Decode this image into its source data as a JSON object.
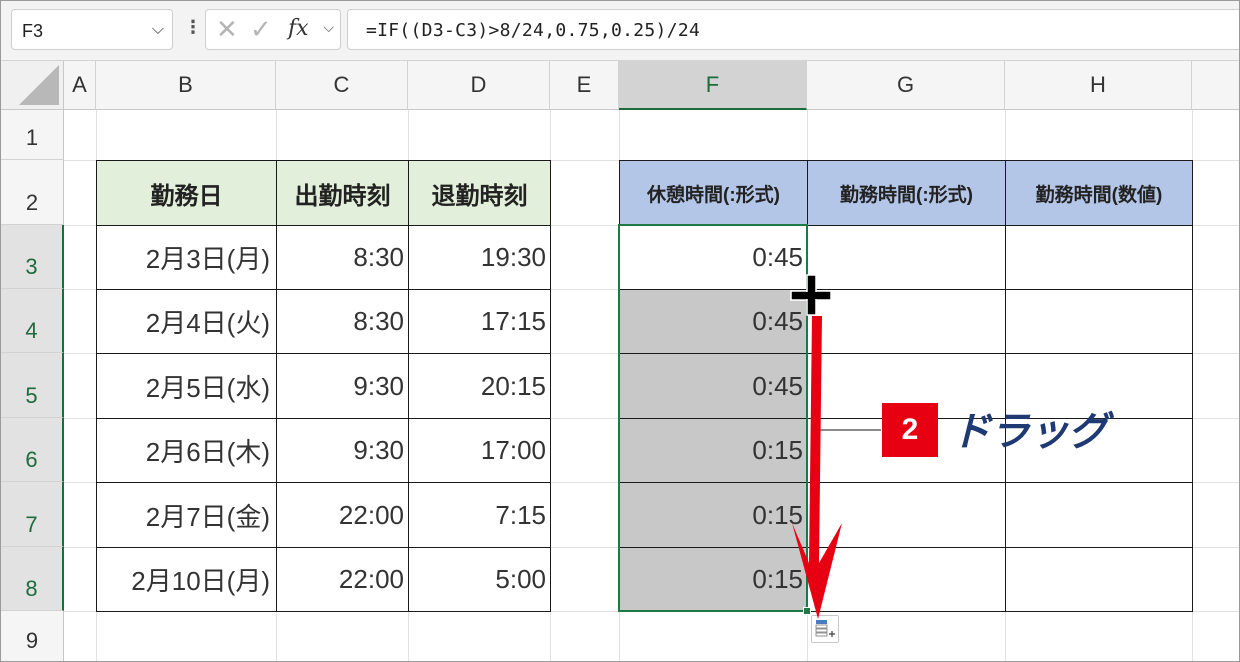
{
  "formula_bar": {
    "name_box": "F3",
    "cancel_icon": "✕",
    "enter_icon": "✓",
    "fx_label": "fx",
    "formula": "=IF((D3-C3)>8/24,0.75,0.25)/24"
  },
  "column_headers": [
    "A",
    "B",
    "C",
    "D",
    "E",
    "F",
    "G",
    "H"
  ],
  "row_headers": [
    "1",
    "2",
    "3",
    "4",
    "5",
    "6",
    "7",
    "8",
    "9"
  ],
  "left_table": {
    "headers": [
      "勤務日",
      "出勤時刻",
      "退勤時刻"
    ],
    "rows": [
      [
        "2月3日(月)",
        "8:30",
        "19:30"
      ],
      [
        "2月4日(火)",
        "8:30",
        "17:15"
      ],
      [
        "2月5日(水)",
        "9:30",
        "20:15"
      ],
      [
        "2月6日(木)",
        "9:30",
        "17:00"
      ],
      [
        "2月7日(金)",
        "22:00",
        "7:15"
      ],
      [
        "2月10日(月)",
        "22:00",
        "5:00"
      ]
    ]
  },
  "right_table": {
    "headers": [
      "休憩時間(:形式)",
      "勤務時間(:形式)",
      "勤務時間(数値)"
    ],
    "f_values": [
      "0:45",
      "0:45",
      "0:45",
      "0:15",
      "0:15",
      "0:15"
    ]
  },
  "annotation": {
    "step_number": "2",
    "label": "ドラッグ",
    "arrow_color": "#e60012",
    "label_color": "#1f3a73"
  },
  "colors": {
    "header_green": "#e2efda",
    "header_blue": "#b4c6e7",
    "selection": "#1e7a45",
    "fill_gray": "#c8c8c8"
  }
}
